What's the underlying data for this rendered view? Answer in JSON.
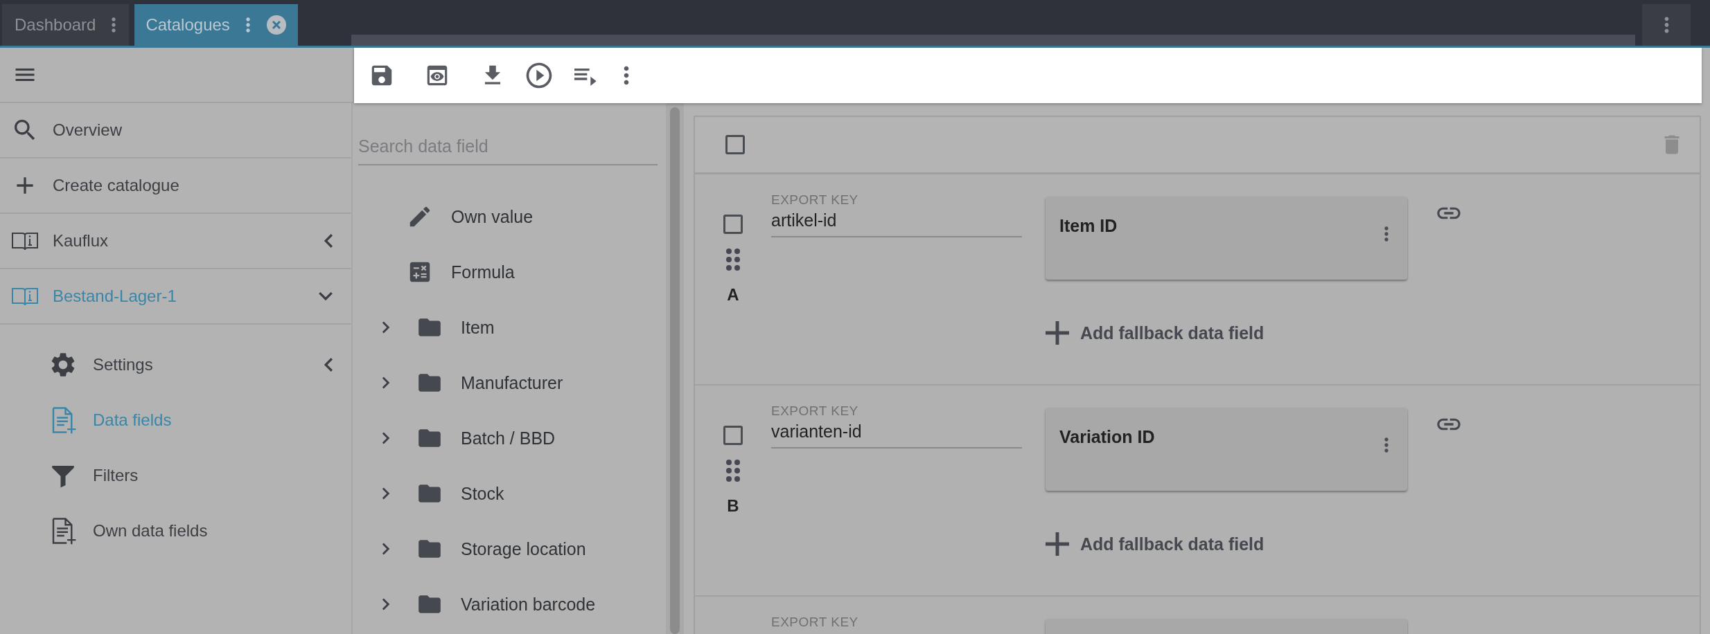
{
  "tabs": [
    {
      "label": "Dashboard",
      "selected": false,
      "closable": false
    },
    {
      "label": "Catalogues",
      "selected": true,
      "closable": true
    }
  ],
  "toolbar": {
    "actions": [
      {
        "kind": "save"
      },
      {
        "kind": "preview"
      },
      {
        "kind": "download"
      },
      {
        "kind": "run"
      },
      {
        "kind": "playlist"
      },
      {
        "kind": "more"
      }
    ]
  },
  "sidebar": {
    "items": [
      {
        "label": "Overview",
        "kind": "search",
        "selected": false
      },
      {
        "label": "Create catalogue",
        "kind": "add",
        "selected": false
      },
      {
        "label": "Kauflux",
        "kind": "catalogue",
        "selected": false,
        "expanded": false
      },
      {
        "label": "Bestand-Lager-1",
        "kind": "catalogue",
        "selected": true,
        "expanded": true,
        "children": [
          {
            "label": "Settings",
            "kind": "settings",
            "selected": false,
            "expanded": false
          },
          {
            "label": "Data fields",
            "kind": "fields",
            "selected": true
          },
          {
            "label": "Filters",
            "kind": "filter",
            "selected": false
          },
          {
            "label": "Own data fields",
            "kind": "fields",
            "selected": false
          }
        ]
      }
    ]
  },
  "data_field_list": {
    "search": {
      "placeholder": "Search data field"
    },
    "items": [
      {
        "label": "Own value",
        "kind": "pencil"
      },
      {
        "label": "Formula",
        "kind": "formula"
      },
      {
        "label": "Item",
        "kind": "folder",
        "expanded": false
      },
      {
        "label": "Manufacturer",
        "kind": "folder",
        "expanded": false
      },
      {
        "label": "Batch / BBD",
        "kind": "folder",
        "expanded": false
      },
      {
        "label": "Stock",
        "kind": "folder",
        "expanded": false
      },
      {
        "label": "Storage location",
        "kind": "folder",
        "expanded": false
      },
      {
        "label": "Variation barcode",
        "kind": "folder",
        "expanded": false
      }
    ]
  },
  "mapping": {
    "select_all": {
      "checked": false
    },
    "rows": [
      {
        "letter": "A",
        "checked": false,
        "key_label": "EXPORT KEY",
        "key": "artikel-id",
        "field": "Item ID",
        "add_fallback": "Add fallback data field"
      },
      {
        "letter": "B",
        "checked": false,
        "key_label": "EXPORT KEY",
        "key": "varianten-id",
        "field": "Variation ID",
        "add_fallback": "Add fallback data field"
      },
      {
        "key_label": "EXPORT KEY"
      }
    ]
  }
}
